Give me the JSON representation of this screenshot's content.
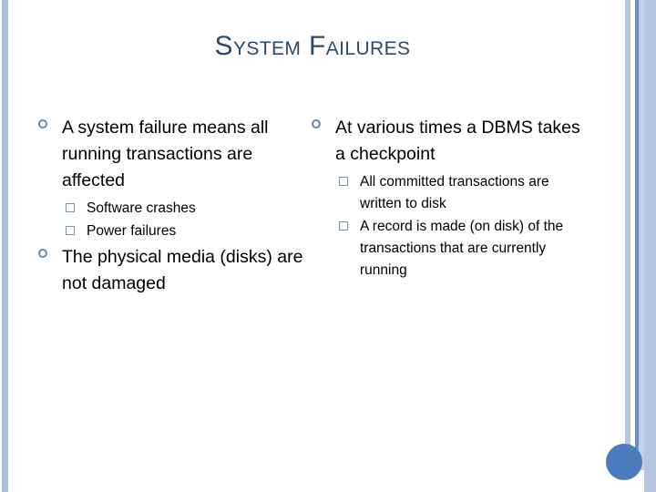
{
  "slide": {
    "title": "System Failures",
    "columns": [
      {
        "name": "left-column",
        "items": [
          {
            "text": "A system failure means all running transactions are affected",
            "bullet": "hollow-circle-bullet-icon",
            "sub": [
              {
                "text": "Software crashes",
                "bullet": "hollow-square-bullet-icon"
              },
              {
                "text": "Power failures",
                "bullet": "hollow-square-bullet-icon"
              }
            ]
          },
          {
            "text": "The physical media (disks) are not damaged",
            "bullet": "hollow-circle-bullet-icon",
            "sub": []
          }
        ]
      },
      {
        "name": "right-column",
        "items": [
          {
            "text": "At various times a DBMS takes a checkpoint",
            "bullet": "hollow-circle-bullet-icon",
            "sub": [
              {
                "text": "All committed transactions are written to disk",
                "bullet": "hollow-square-bullet-icon"
              },
              {
                "text": "A record is made (on disk) of the transactions that are currently running",
                "bullet": "hollow-square-bullet-icon"
              }
            ]
          }
        ]
      }
    ]
  },
  "decor": {
    "title_color": "#2d4a6d",
    "edge_bar_color": "#aec0dc",
    "stripe_light_color": "#b9c8e2",
    "stripe_dark_color": "#6e8fc0",
    "stripe_wide_color": "#b6c6e1",
    "circle_color": "#4a7cbd",
    "background_color": "#ffffff"
  }
}
